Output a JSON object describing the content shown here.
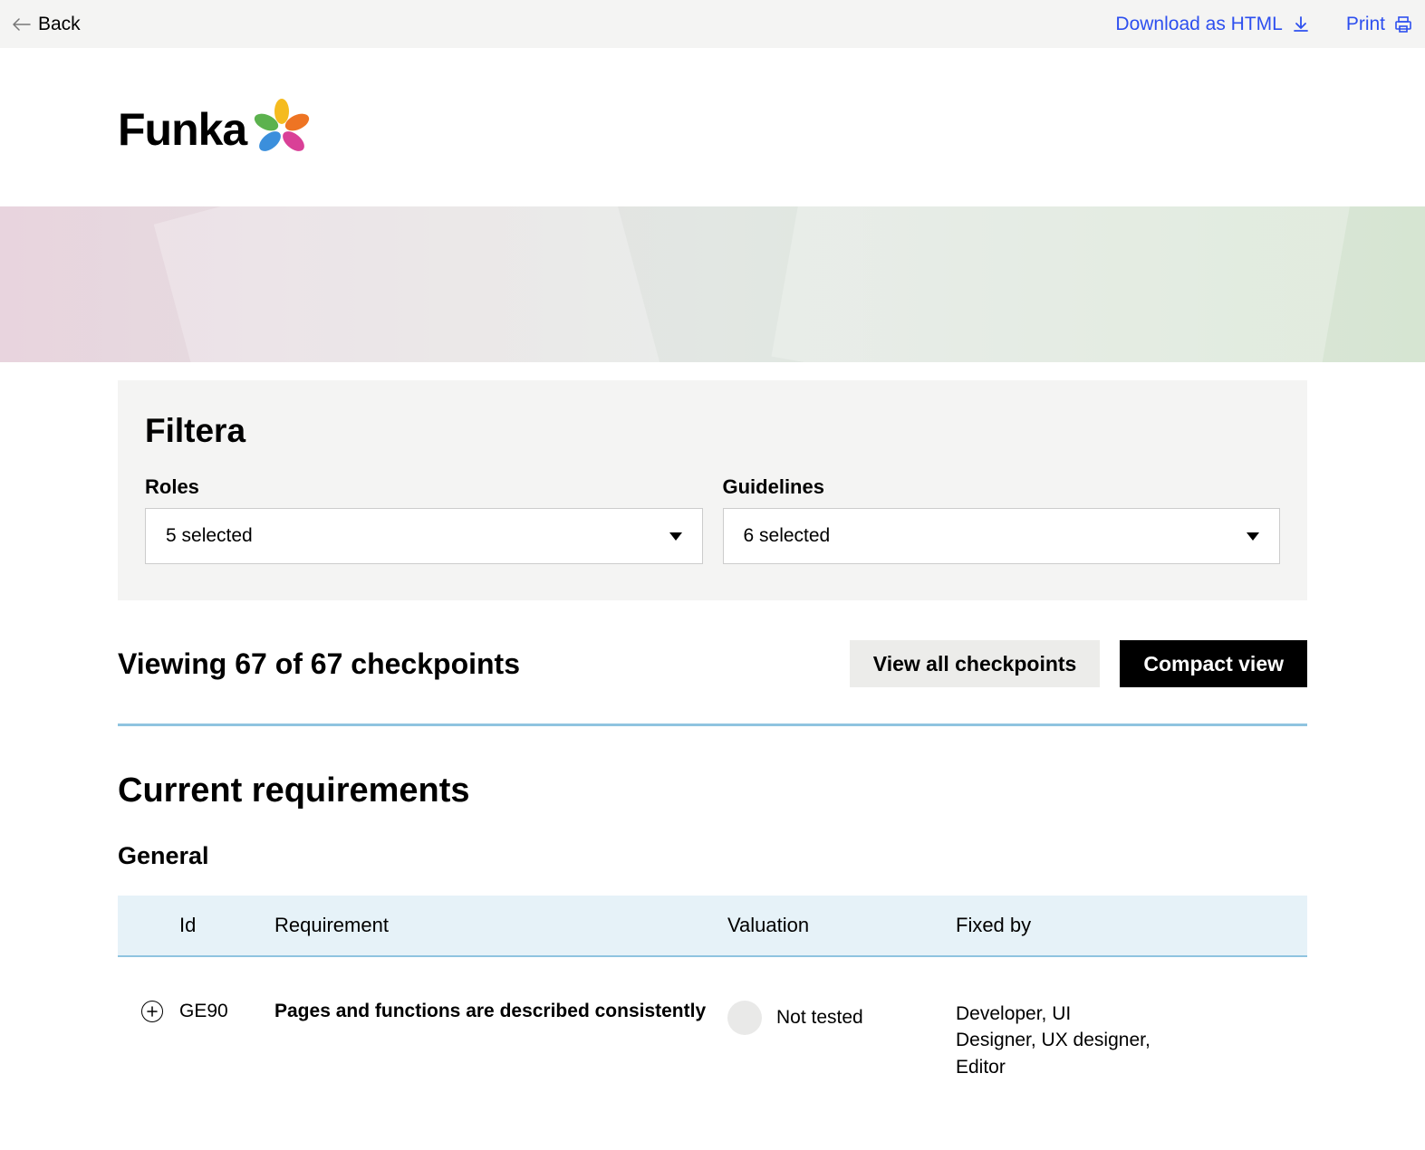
{
  "topbar": {
    "back": "Back",
    "download": "Download as HTML",
    "print": "Print"
  },
  "logo": {
    "text": "Funka"
  },
  "filter": {
    "title": "Filtera",
    "roles_label": "Roles",
    "roles_value": "5 selected",
    "guidelines_label": "Guidelines",
    "guidelines_value": "6 selected"
  },
  "viewing": {
    "text": "Viewing 67 of 67 checkpoints",
    "view_all": "View all checkpoints",
    "compact": "Compact view"
  },
  "requirements": {
    "title": "Current requirements",
    "general": "General"
  },
  "table": {
    "headers": {
      "id": "Id",
      "requirement": "Requirement",
      "valuation": "Valuation",
      "fixed_by": "Fixed by"
    },
    "rows": [
      {
        "id": "GE90",
        "requirement": "Pages and functions are described consistently",
        "valuation": "Not tested",
        "fixed_by": "Developer, UI Designer, UX designer, Editor"
      }
    ]
  }
}
